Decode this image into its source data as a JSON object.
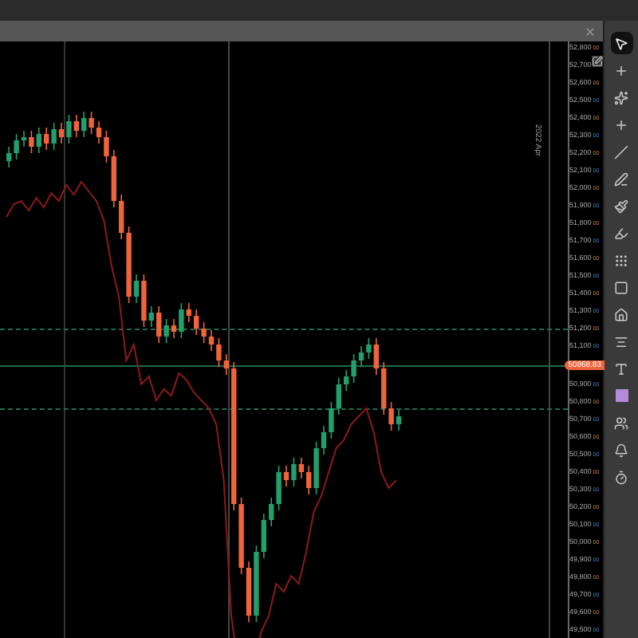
{
  "price_axis": {
    "items": [
      {
        "kind": "label",
        "text": "52,800",
        "decimals": "00"
      },
      {
        "kind": "label",
        "text": "52,700"
      },
      {
        "kind": "label",
        "text": "52,600",
        "decimals": "00"
      },
      {
        "kind": "label",
        "text": "52,500",
        "decimals": "00"
      },
      {
        "kind": "label",
        "text": "52,400",
        "decimals": "00"
      },
      {
        "kind": "label",
        "text": "52,300",
        "decimals": "00"
      },
      {
        "kind": "label",
        "text": "52,200",
        "decimals": "00"
      },
      {
        "kind": "label",
        "text": "52,100",
        "decimals": "00"
      },
      {
        "kind": "label",
        "text": "52,000",
        "decimals": "00"
      },
      {
        "kind": "label",
        "text": "51,900",
        "decimals": "00"
      },
      {
        "kind": "label",
        "text": "51,800",
        "decimals": "00"
      },
      {
        "kind": "label",
        "text": "51,700",
        "decimals": "00"
      },
      {
        "kind": "label",
        "text": "51,600",
        "decimals": "00"
      },
      {
        "kind": "label",
        "text": "51,500",
        "decimals": "00"
      },
      {
        "kind": "label",
        "text": "51,400",
        "decimals": "00"
      },
      {
        "kind": "label",
        "text": "51,300",
        "decimals": "00"
      },
      {
        "kind": "label",
        "text": "51,200",
        "decimals": "00"
      },
      {
        "kind": "label",
        "text": "51,100",
        "decimals": "00"
      },
      {
        "kind": "tag",
        "text": "50868.83"
      },
      {
        "kind": "label",
        "text": "50,900",
        "decimals": "00"
      },
      {
        "kind": "label",
        "text": "50,800",
        "decimals": "00"
      },
      {
        "kind": "label",
        "text": "50,700",
        "decimals": "00"
      },
      {
        "kind": "label",
        "text": "50,600",
        "decimals": "00"
      },
      {
        "kind": "label",
        "text": "50,500",
        "decimals": "00"
      },
      {
        "kind": "label",
        "text": "50,400",
        "decimals": "00"
      },
      {
        "kind": "label",
        "text": "50,300",
        "decimals": "00"
      },
      {
        "kind": "label",
        "text": "50,200",
        "decimals": "00"
      },
      {
        "kind": "label",
        "text": "50,100",
        "decimals": "00"
      },
      {
        "kind": "label",
        "text": "50,000",
        "decimals": "00"
      },
      {
        "kind": "label",
        "text": "49,900",
        "decimals": "00"
      },
      {
        "kind": "label",
        "text": "49,800",
        "decimals": "00"
      },
      {
        "kind": "label",
        "text": "49,700",
        "decimals": "00"
      },
      {
        "kind": "label",
        "text": "49,600",
        "decimals": "00"
      },
      {
        "kind": "label",
        "text": "49,500",
        "decimals": "00"
      }
    ]
  },
  "date_marker": "2022 Apr",
  "toolbar": [
    {
      "kind": "pointer",
      "selected": true
    },
    {
      "kind": "cross",
      "selected": false
    },
    {
      "kind": "sparkle",
      "selected": false
    },
    {
      "kind": "plus",
      "selected": false
    },
    {
      "kind": "line",
      "selected": false
    },
    {
      "kind": "pen",
      "selected": false
    },
    {
      "kind": "brush",
      "selected": false
    },
    {
      "kind": "marker",
      "selected": false
    },
    {
      "kind": "grid",
      "selected": false
    },
    {
      "kind": "rect",
      "selected": false
    },
    {
      "kind": "home",
      "selected": false
    },
    {
      "kind": "level",
      "selected": false
    },
    {
      "kind": "text",
      "selected": false
    },
    {
      "kind": "color",
      "selected": false
    },
    {
      "kind": "group",
      "selected": false
    },
    {
      "kind": "bell",
      "selected": false
    },
    {
      "kind": "timer",
      "selected": false
    }
  ]
}
